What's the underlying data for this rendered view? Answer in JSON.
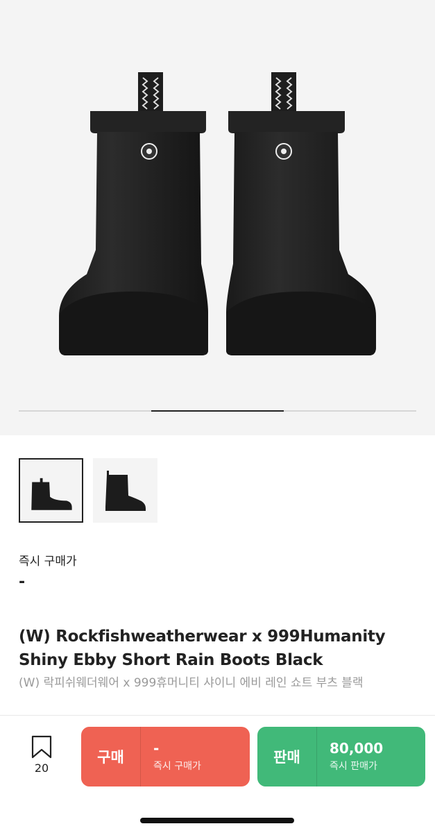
{
  "product": {
    "image_count": 3,
    "active_image": 2,
    "thumbnails": [
      {
        "alt": "side view"
      },
      {
        "alt": "angle view"
      }
    ]
  },
  "price": {
    "label": "즉시 구매가",
    "value": "-"
  },
  "title": {
    "en": "(W) Rockfishweatherwear x 999Humanity Shiny Ebby Short Rain Boots Black",
    "ko": "(W) 락피쉬웨더웨어 x 999휴머니티 샤이니 에비 레인 쇼트 부츠 블랙"
  },
  "bottom_bar": {
    "wish_count": "20",
    "buy": {
      "kind": "구매",
      "amount": "-",
      "sub": "즉시 구매가"
    },
    "sell": {
      "kind": "판매",
      "amount": "80,000",
      "sub": "즉시 판매가"
    }
  },
  "colors": {
    "buy": "#ef6253",
    "sell": "#41b979",
    "image_bg": "#f4f4f4"
  }
}
